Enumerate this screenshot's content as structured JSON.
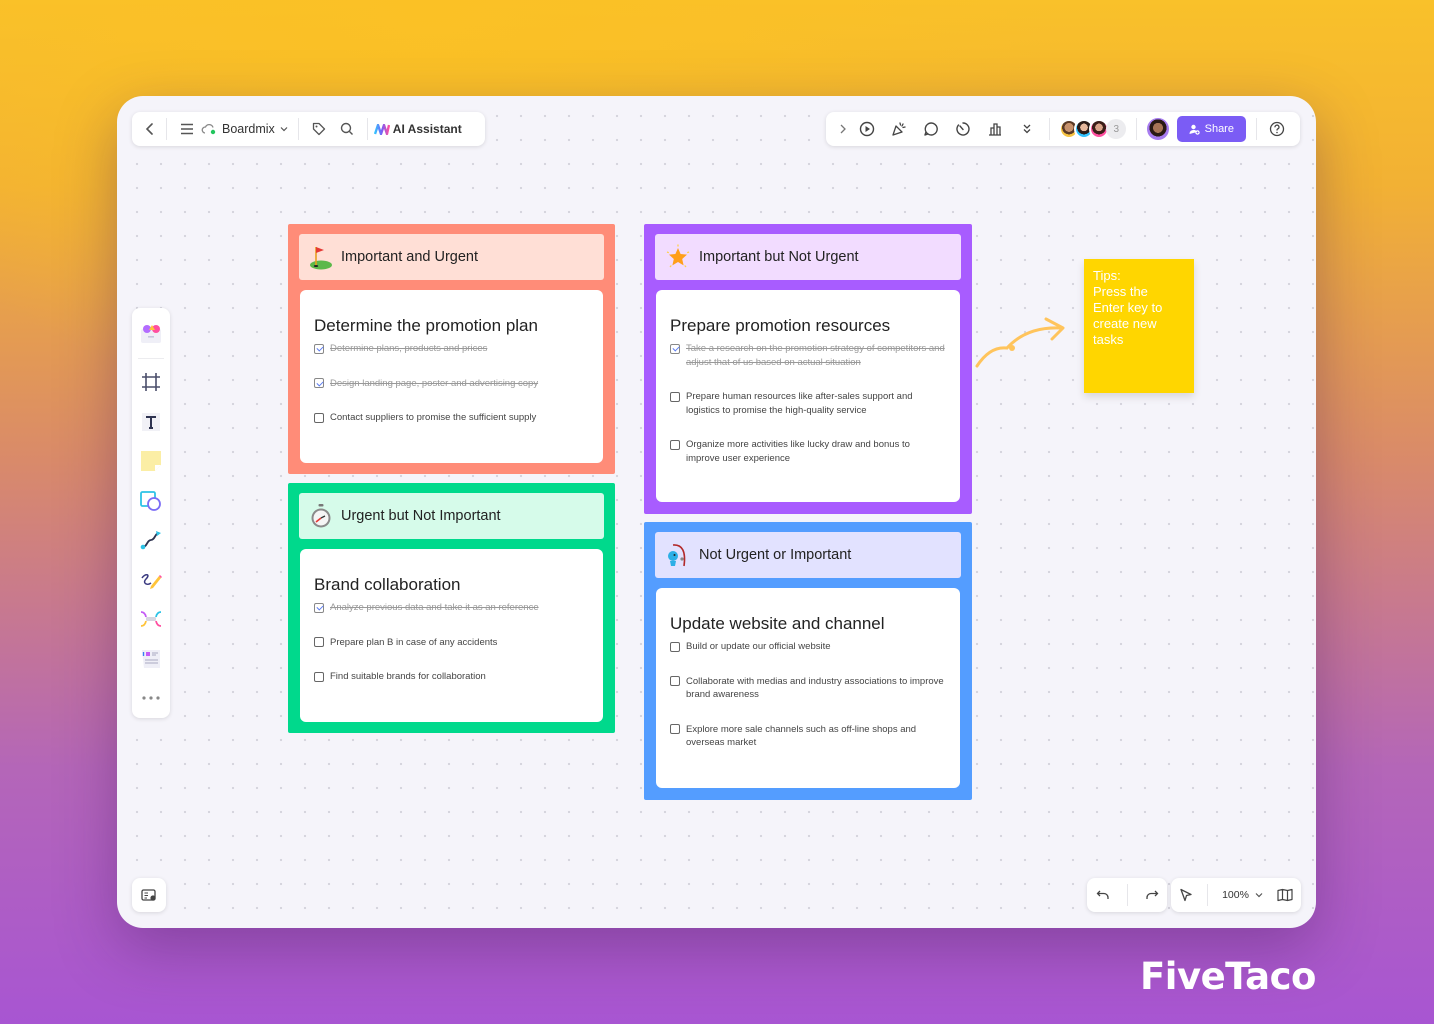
{
  "toolbar_left": {
    "back_icon": "chevron-left-icon",
    "menu_icon": "hamburger-menu-icon",
    "board_name": "Boardmix",
    "tag_icon": "tag-icon",
    "search_icon": "search-icon",
    "ai_assistant_label": "AI Assistant"
  },
  "toolbar_right": {
    "icons": [
      "chevron-right-icon",
      "play-icon",
      "celebrate-icon",
      "comment-icon",
      "timer-icon",
      "vote-icon",
      "more-chevrons-icon"
    ],
    "collaborator_extra_count": "3",
    "share_label": "Share",
    "help_icon": "help-icon"
  },
  "sidebar": {
    "items": [
      "templates",
      "frame",
      "text",
      "sticky-note",
      "shape",
      "connector",
      "pen",
      "mindmap",
      "table-template",
      "more"
    ]
  },
  "quadrants": [
    {
      "id": "important-urgent",
      "header": "Important and Urgent",
      "icon": "golf-flag-icon",
      "border_color": "#ff8c78",
      "header_bg": "#ffdfd6",
      "title": "Determine the promotion plan",
      "tasks": [
        {
          "text": "Determine plans, products and prices",
          "done": true
        },
        {
          "text": "Design landing page, poster and advertising copy",
          "done": true
        },
        {
          "text": "Contact suppliers to promise the sufficient supply",
          "done": false
        }
      ]
    },
    {
      "id": "important-not-urgent",
      "header": "Important but Not Urgent",
      "icon": "star-icon",
      "border_color": "#a85cff",
      "header_bg": "#f2dcff",
      "title": "Prepare promotion resources",
      "tasks": [
        {
          "text": "Take a research on the promotion strategy of competitors and adjust that of us based on actual situation",
          "done": true
        },
        {
          "text": "Prepare human resources like after-sales support and logistics to promise the high-quality service",
          "done": false
        },
        {
          "text": "Organize more activities like lucky draw and bonus to improve user experience",
          "done": false
        }
      ]
    },
    {
      "id": "urgent-not-important",
      "header": "Urgent but Not Important",
      "icon": "stopwatch-icon",
      "border_color": "#00d98c",
      "header_bg": "#d6fbea",
      "title": "Brand collaboration",
      "tasks": [
        {
          "text": "Analyze previous data and take it as an reference",
          "done": true
        },
        {
          "text": "Prepare plan B in case of any accidents",
          "done": false
        },
        {
          "text": "Find suitable brands for collaboration",
          "done": false
        }
      ]
    },
    {
      "id": "not-urgent-not-important",
      "header": "Not Urgent or Important",
      "icon": "fishing-icon",
      "border_color": "#549dff",
      "header_bg": "#e2e2ff",
      "title": "Update website and channel",
      "tasks": [
        {
          "text": "Build or update our official website",
          "done": false
        },
        {
          "text": "Collaborate with medias and industry associations to improve brand awareness",
          "done": false
        },
        {
          "text": "Explore more sale channels such as off-line shops and overseas market",
          "done": false
        }
      ]
    }
  ],
  "sticky_note": {
    "lines": [
      "Tips:",
      "Press the",
      "Enter key to",
      "create new",
      "tasks"
    ],
    "color": "#ffd600"
  },
  "bottom": {
    "zoom_level": "100%"
  },
  "watermark": "FiveTaco"
}
